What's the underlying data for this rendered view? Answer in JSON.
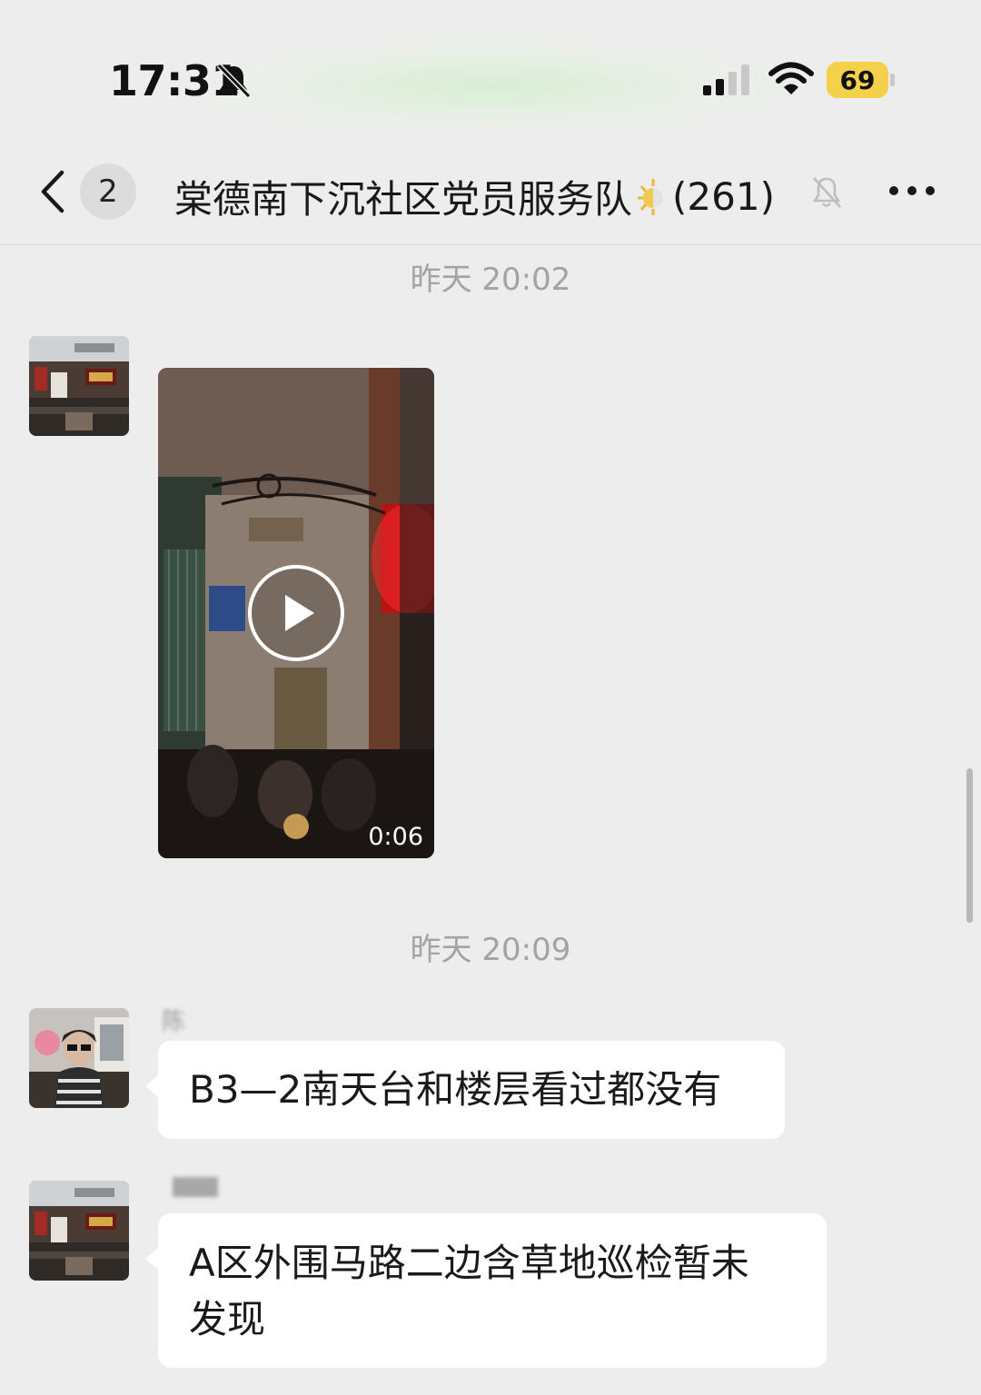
{
  "status_bar": {
    "time": "17:31",
    "battery_level": "69",
    "battery_color": "#f4d14a",
    "icons": [
      "bell-off-icon",
      "signal-icon",
      "wifi-icon",
      "battery-icon"
    ]
  },
  "nav": {
    "unread_count": "2",
    "title": "棠德南下沉社区党员服务队",
    "title_emoji": "sun-emoji",
    "member_count": "(261)",
    "icons": [
      "back-icon",
      "mute-icon",
      "more-icon"
    ]
  },
  "messages": [
    {
      "type": "timestamp",
      "text": "昨天 20:02"
    },
    {
      "type": "video",
      "duration": "0:06"
    },
    {
      "type": "timestamp",
      "text": "昨天 20:09"
    },
    {
      "type": "text",
      "sender": "陈",
      "text": "B3—2南天台和楼层看过都没有"
    },
    {
      "type": "text",
      "sender": "",
      "text_lines": [
        "A区外围马路二边含草地巡检暂未",
        "发现"
      ]
    }
  ]
}
